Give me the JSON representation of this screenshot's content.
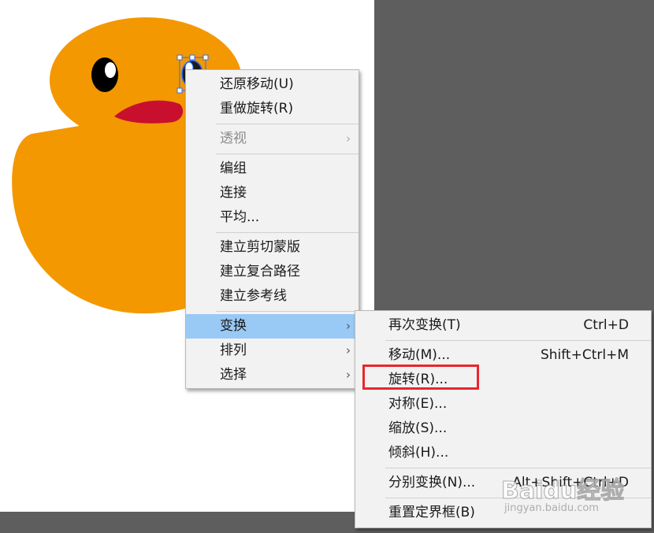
{
  "context_menu": {
    "items": [
      {
        "label": "还原移动(U)",
        "has_submenu": false,
        "disabled": false
      },
      {
        "label": "重做旋转(R)",
        "has_submenu": false,
        "disabled": false
      },
      {
        "label": "透视",
        "has_submenu": true,
        "disabled": true
      },
      {
        "label": "编组",
        "has_submenu": false,
        "disabled": false
      },
      {
        "label": "连接",
        "has_submenu": false,
        "disabled": false
      },
      {
        "label": "平均...",
        "has_submenu": false,
        "disabled": false
      },
      {
        "label": "建立剪切蒙版",
        "has_submenu": false,
        "disabled": false
      },
      {
        "label": "建立复合路径",
        "has_submenu": false,
        "disabled": false
      },
      {
        "label": "建立参考线",
        "has_submenu": false,
        "disabled": false
      },
      {
        "label": "变换",
        "has_submenu": true,
        "disabled": false,
        "highlighted": true
      },
      {
        "label": "排列",
        "has_submenu": true,
        "disabled": false
      },
      {
        "label": "选择",
        "has_submenu": true,
        "disabled": false
      }
    ],
    "arrow_glyph": "›"
  },
  "transform_submenu": {
    "items": [
      {
        "label": "再次变换(T)",
        "shortcut": "Ctrl+D"
      },
      {
        "label": "移动(M)...",
        "shortcut": "Shift+Ctrl+M"
      },
      {
        "label": "旋转(R)...",
        "shortcut": "",
        "annotated": true
      },
      {
        "label": "对称(E)...",
        "shortcut": ""
      },
      {
        "label": "缩放(S)...",
        "shortcut": ""
      },
      {
        "label": "倾斜(H)...",
        "shortcut": ""
      },
      {
        "label": "分别变换(N)...",
        "shortcut": "Alt+Shift+Ctrl+D"
      },
      {
        "label": "重置定界框(B)",
        "shortcut": ""
      }
    ]
  },
  "watermark": {
    "logo": "Baidu经验",
    "url": "jingyan.baidu.com"
  },
  "colors": {
    "duck_body": "#f39800",
    "beak": "#c8102e",
    "menu_bg": "#f2f2f2",
    "highlight": "#99c9f5",
    "annotation_box": "#e8262d",
    "pasteboard": "#5e5e5e"
  }
}
